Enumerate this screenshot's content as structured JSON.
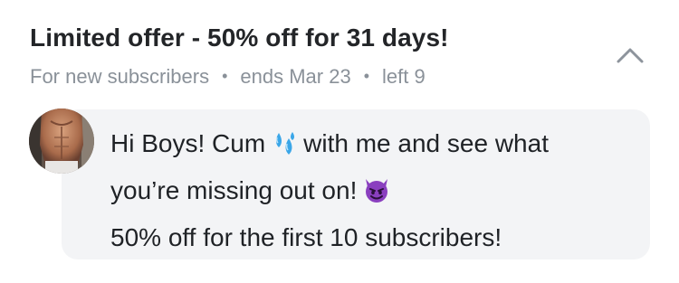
{
  "offer": {
    "title": "Limited offer - 50% off for 31 days!",
    "audience": "For new subscribers",
    "ends": "ends Mar 23",
    "left": "left 9",
    "separator": "•"
  },
  "message": {
    "line1_a": "Hi Boys! Cum",
    "line1_b": "with me and see what",
    "line2": "you’re missing out on!",
    "line3": "50% off for the first 10 subscribers!",
    "emoji_1": "sweat-droplets-icon",
    "emoji_2": "smiling-devil-icon"
  },
  "colors": {
    "title": "#232528",
    "meta": "#8a9199",
    "bubble": "#f3f4f6",
    "chevron": "#8d949c",
    "devil": "#8a3fbf",
    "droplets": "#3aa6e8"
  }
}
